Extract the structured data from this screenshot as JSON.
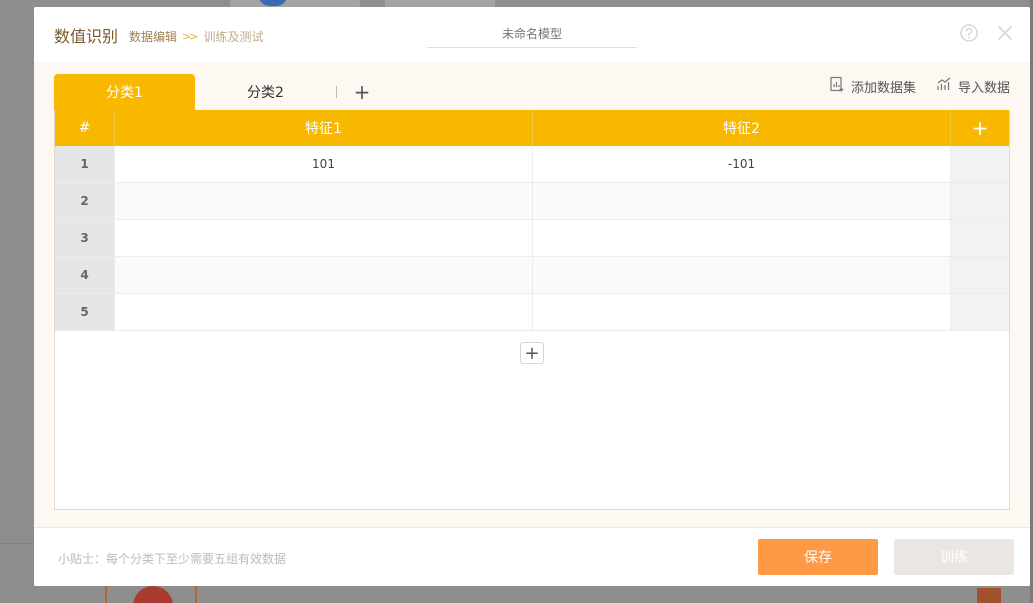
{
  "header": {
    "title": "数值识别",
    "breadcrumb": [
      "数据编辑",
      "训练及测试"
    ],
    "breadcrumb_sep": ">>",
    "model_name_placeholder": "未命名模型"
  },
  "tabs": [
    {
      "label": "分类1",
      "active": true
    },
    {
      "label": "分类2",
      "active": false
    }
  ],
  "tab_add_label": "+",
  "toolbar": {
    "add_dataset": "添加数据集",
    "import_data": "导入数据"
  },
  "table": {
    "headers": [
      "#",
      "特征1",
      "特征2",
      "+"
    ],
    "rows": [
      [
        "1",
        "101",
        "-101"
      ],
      [
        "2",
        "",
        ""
      ],
      [
        "3",
        "",
        ""
      ],
      [
        "4",
        "",
        ""
      ],
      [
        "5",
        "",
        ""
      ]
    ],
    "add_row_label": "+"
  },
  "footer": {
    "tip": "小贴士：每个分类下至少需要五组有效数据",
    "save_label": "保存",
    "train_label": "训练"
  },
  "colors": {
    "accent": "#f9b800",
    "save": "#fe9a45",
    "train_disabled": "#ebe6e2"
  },
  "icons": [
    "help-icon",
    "close-icon",
    "add-dataset-icon",
    "import-data-icon",
    "plus-icon"
  ]
}
